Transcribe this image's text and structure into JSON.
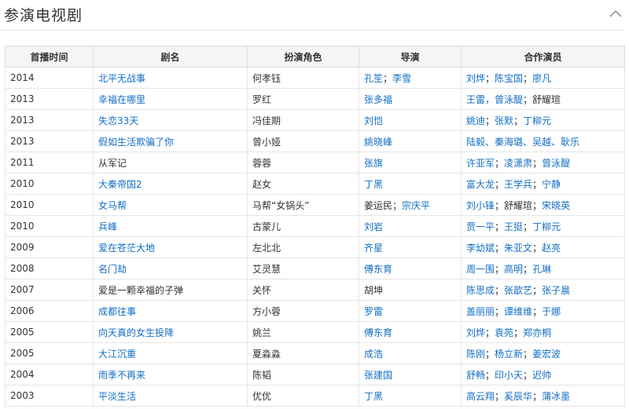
{
  "section": {
    "title": "参演电视剧"
  },
  "table": {
    "headers": [
      "首播时间",
      "剧名",
      "扮演角色",
      "导演",
      "合作演员"
    ],
    "rows": [
      {
        "year": "2014",
        "title": "北平无战事",
        "title_link": true,
        "role": "何孝钰",
        "directors": [
          {
            "t": "孔笙",
            "l": true
          },
          {
            "t": "李雪",
            "l": true
          }
        ],
        "actors": [
          {
            "t": "刘烨",
            "l": true
          },
          {
            "t": "陈宝国",
            "l": true
          },
          {
            "t": "廖凡",
            "l": true
          }
        ]
      },
      {
        "year": "2013",
        "title": "幸福在哪里",
        "title_link": true,
        "role": "罗红",
        "directors": [
          {
            "t": "张多福",
            "l": true
          }
        ],
        "actors": [
          {
            "t": "王雷，曾泳醍",
            "l": true
          },
          {
            "t": "舒耀瑄",
            "l": false
          }
        ]
      },
      {
        "year": "2013",
        "title": "失恋33天",
        "title_link": true,
        "role": "冯佳期",
        "directors": [
          {
            "t": "刘恺",
            "l": true
          }
        ],
        "actors": [
          {
            "t": "姚迪",
            "l": true
          },
          {
            "t": "张默",
            "l": true
          },
          {
            "t": "丁柳元",
            "l": true
          }
        ]
      },
      {
        "year": "2013",
        "title": "假如生活欺骗了你",
        "title_link": true,
        "role": " 曾小娅",
        "directors": [
          {
            "t": "姚晓峰",
            "l": true
          }
        ],
        "actors": [
          {
            "t": "陆毅、秦海璐、吴越、耿乐",
            "l": true
          }
        ]
      },
      {
        "year": "2011",
        "title": "从军记",
        "title_link": false,
        "role": "蓉蓉",
        "directors": [
          {
            "t": "张旗",
            "l": true
          }
        ],
        "actors": [
          {
            "t": "许亚军",
            "l": true
          },
          {
            "t": "凌潇肃",
            "l": true
          },
          {
            "t": "曾泳醍",
            "l": true
          }
        ]
      },
      {
        "year": "2010",
        "title": "大秦帝国2",
        "title_link": true,
        "role": "赵女",
        "directors": [
          {
            "t": "丁黑",
            "l": true
          }
        ],
        "actors": [
          {
            "t": "富大龙",
            "l": true
          },
          {
            "t": "王学兵",
            "l": true
          },
          {
            "t": "宁静",
            "l": true
          }
        ]
      },
      {
        "year": "2010",
        "title": "女马帮",
        "title_link": true,
        "role": "马帮“女锅头”",
        "directors": [
          {
            "t": "姜运民",
            "l": false
          },
          {
            "t": "宗庆平",
            "l": true
          }
        ],
        "actors": [
          {
            "t": "刘小锋",
            "l": true
          },
          {
            "t": "舒耀瑄",
            "l": false
          },
          {
            "t": "宋晓英",
            "l": true
          }
        ]
      },
      {
        "year": "2010",
        "title": "兵峰",
        "title_link": true,
        "role": "古蒙儿",
        "directors": [
          {
            "t": "刘岩",
            "l": true
          }
        ],
        "actors": [
          {
            "t": "贾一平",
            "l": true
          },
          {
            "t": "王挺",
            "l": true
          },
          {
            "t": "丁柳元",
            "l": true
          }
        ]
      },
      {
        "year": "2009",
        "title": "爱在苍茫大地",
        "title_link": true,
        "role": "左北北",
        "directors": [
          {
            "t": "齐星",
            "l": true
          }
        ],
        "actors": [
          {
            "t": "李幼斌",
            "l": true
          },
          {
            "t": "朱亚文",
            "l": true
          },
          {
            "t": "赵亮",
            "l": true
          }
        ]
      },
      {
        "year": "2008",
        "title": "名门劫",
        "title_link": true,
        "role": "艾灵慧",
        "directors": [
          {
            "t": "傅东育",
            "l": true
          }
        ],
        "actors": [
          {
            "t": "周一围",
            "l": true
          },
          {
            "t": "高明",
            "l": true
          },
          {
            "t": "孔琳",
            "l": true
          }
        ]
      },
      {
        "year": "2007",
        "title": "爱是一颗幸福的子弹",
        "title_link": false,
        "role": "关怀",
        "directors": [
          {
            "t": "胡坤",
            "l": false
          }
        ],
        "actors": [
          {
            "t": "陈思成",
            "l": true
          },
          {
            "t": "张歆艺",
            "l": true
          },
          {
            "t": "张子晨",
            "l": true
          }
        ]
      },
      {
        "year": "2006",
        "title": "成都往事",
        "title_link": true,
        "role": "方小蓉",
        "directors": [
          {
            "t": "罗雷",
            "l": true
          }
        ],
        "actors": [
          {
            "t": "盖丽丽",
            "l": true
          },
          {
            "t": "谭维维",
            "l": true
          },
          {
            "t": "于娜",
            "l": true
          }
        ]
      },
      {
        "year": "2005",
        "title": "向天真的女生投降",
        "title_link": true,
        "role": "姚兰",
        "directors": [
          {
            "t": "傅东育",
            "l": true
          }
        ],
        "actors": [
          {
            "t": "刘烨",
            "l": true
          },
          {
            "t": "袁苑",
            "l": true
          },
          {
            "t": "郑亦桐",
            "l": true
          }
        ]
      },
      {
        "year": "2005",
        "title": "大江沉重",
        "title_link": true,
        "role": "夏淼淼",
        "directors": [
          {
            "t": "成浩",
            "l": true
          }
        ],
        "actors": [
          {
            "t": "陈刚",
            "l": true
          },
          {
            "t": "杨立新",
            "l": true
          },
          {
            "t": "姜宏波",
            "l": true
          }
        ]
      },
      {
        "year": "2004",
        "title": "雨季不再来",
        "title_link": true,
        "role": "陈韬",
        "directors": [
          {
            "t": "张建国",
            "l": true
          }
        ],
        "actors": [
          {
            "t": "舒畅",
            "l": true
          },
          {
            "t": "印小天",
            "l": true
          },
          {
            "t": "迟帅",
            "l": true
          }
        ]
      },
      {
        "year": "2003",
        "title": "平淡生活",
        "title_link": true,
        "role": "优优",
        "directors": [
          {
            "t": "丁黑",
            "l": true
          }
        ],
        "actors": [
          {
            "t": "高云翔",
            "l": true
          },
          {
            "t": "奚辰华",
            "l": true
          },
          {
            "t": "蒲冰墨",
            "l": true
          }
        ]
      }
    ]
  }
}
